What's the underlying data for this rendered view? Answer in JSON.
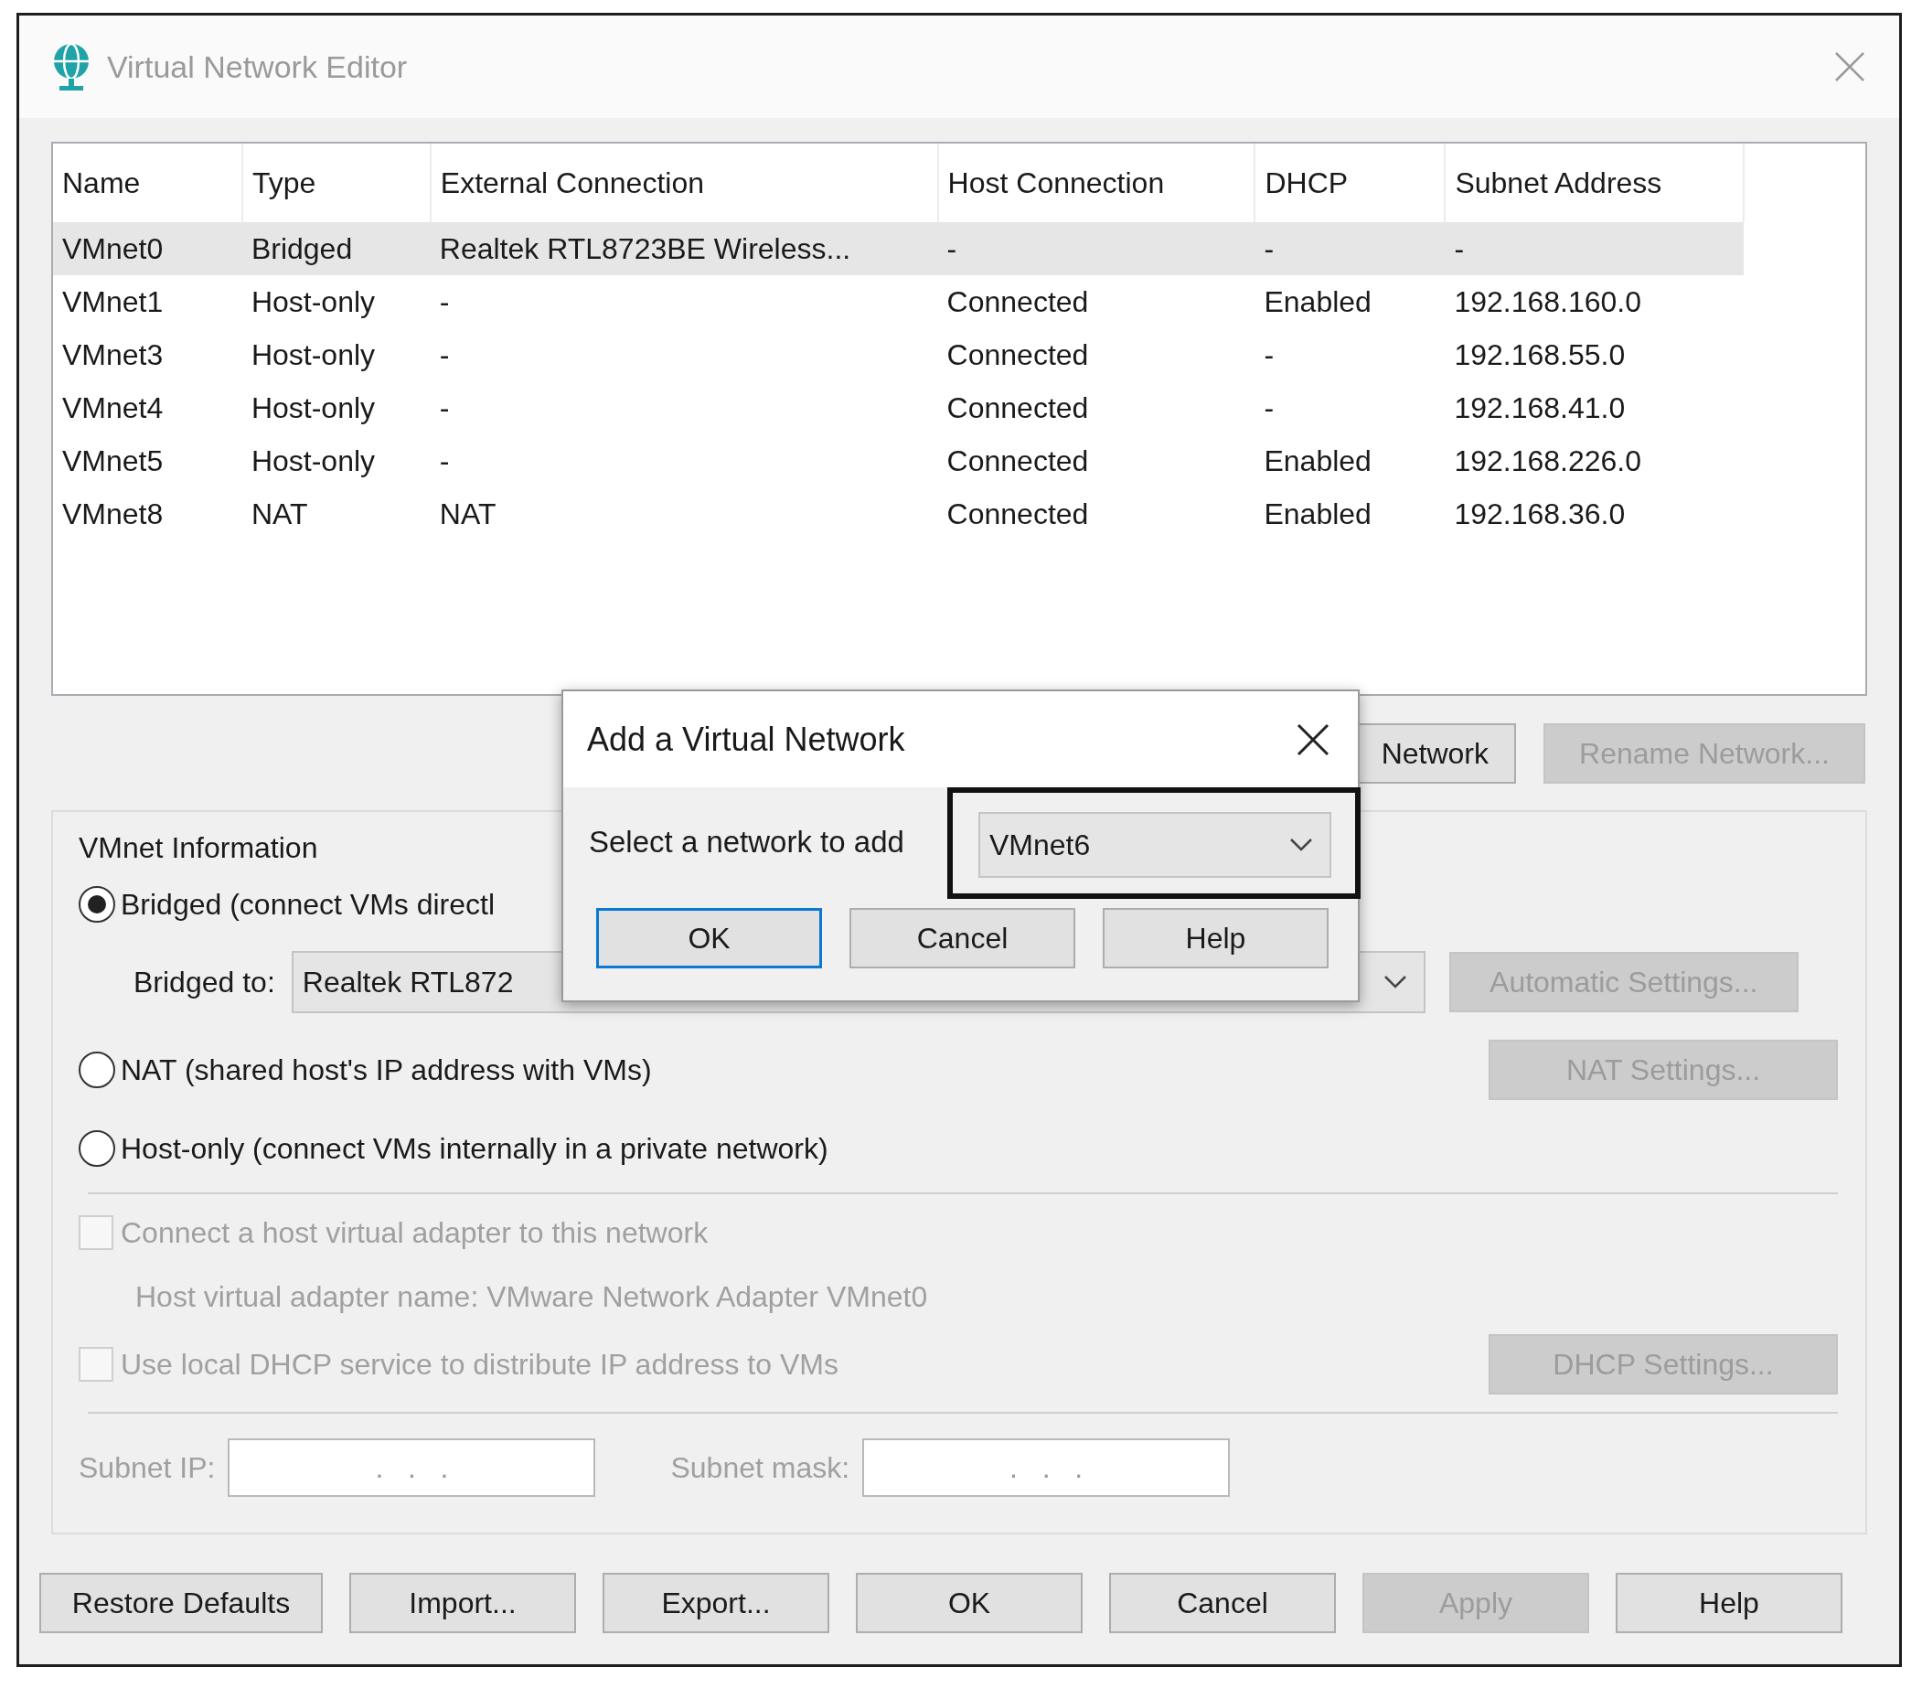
{
  "window": {
    "title": "Virtual Network Editor"
  },
  "table": {
    "columns": [
      "Name",
      "Type",
      "External Connection",
      "Host Connection",
      "DHCP",
      "Subnet Address"
    ],
    "rows": [
      {
        "cells": [
          "VMnet0",
          "Bridged",
          "Realtek RTL8723BE Wireless...",
          "-",
          "-",
          "-"
        ],
        "selected": true
      },
      {
        "cells": [
          "VMnet1",
          "Host-only",
          "-",
          "Connected",
          "Enabled",
          "192.168.160.0"
        ],
        "selected": false
      },
      {
        "cells": [
          "VMnet3",
          "Host-only",
          "-",
          "Connected",
          "-",
          "192.168.55.0"
        ],
        "selected": false
      },
      {
        "cells": [
          "VMnet4",
          "Host-only",
          "-",
          "Connected",
          "-",
          "192.168.41.0"
        ],
        "selected": false
      },
      {
        "cells": [
          "VMnet5",
          "Host-only",
          "-",
          "Connected",
          "Enabled",
          "192.168.226.0"
        ],
        "selected": false
      },
      {
        "cells": [
          "VMnet8",
          "NAT",
          "NAT",
          "Connected",
          "Enabled",
          "192.168.36.0"
        ],
        "selected": false
      }
    ]
  },
  "network_buttons": [
    {
      "label": "Network",
      "disabled": false
    },
    {
      "label": "Rename Network...",
      "disabled": true
    }
  ],
  "vmnet_information": {
    "title": "VMnet Information",
    "radios": [
      {
        "label": "Bridged (connect VMs directl",
        "selected": true
      },
      {
        "label": "NAT (shared host's IP address with VMs)",
        "selected": false
      },
      {
        "label": "Host-only (connect VMs internally in a private network)",
        "selected": false
      }
    ],
    "bridged_to": {
      "label": "Bridged to:",
      "value": "Realtek RTL872"
    },
    "automatic_settings": {
      "label": "Automatic Settings...",
      "disabled": true
    },
    "nat_settings": {
      "label": "NAT Settings...",
      "disabled": true
    },
    "checkboxes": [
      {
        "label": "Connect a host virtual adapter to this network",
        "checked": false,
        "disabled": true
      },
      {
        "label": "Use local DHCP service to distribute IP address to VMs",
        "checked": false,
        "disabled": true
      }
    ],
    "adapter_name": "Host virtual adapter name: VMware Network Adapter VMnet0",
    "dhcp_settings": {
      "label": "DHCP Settings...",
      "disabled": true
    },
    "subnet_ip": {
      "label": "Subnet IP:",
      "value": ".   .   ."
    },
    "subnet_mask": {
      "label": "Subnet mask:",
      "value": ".   .   ."
    }
  },
  "buttons": [
    {
      "label": "Restore Defaults",
      "disabled": false
    },
    {
      "label": "Import...",
      "disabled": false
    },
    {
      "label": "Export...",
      "disabled": false
    },
    {
      "label": "OK",
      "disabled": false
    },
    {
      "label": "Cancel",
      "disabled": false
    },
    {
      "label": "Apply",
      "disabled": true
    },
    {
      "label": "Help",
      "disabled": false
    }
  ],
  "dialog": {
    "title": "Add a Virtual Network",
    "label": "Select a network to add",
    "select": {
      "value": "VMnet6"
    },
    "buttons": [
      {
        "label": "OK",
        "default": true
      },
      {
        "label": "Cancel",
        "default": false
      },
      {
        "label": "Help",
        "default": false
      }
    ]
  }
}
